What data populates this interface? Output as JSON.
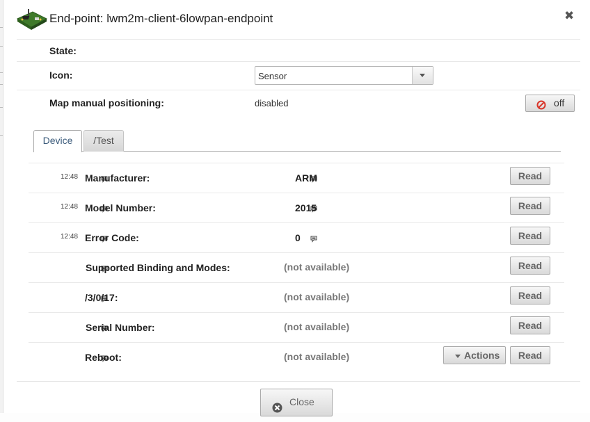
{
  "dialog": {
    "title": "End-point: lwm2m-client-6lowpan-endpoint",
    "icons": {
      "device": "device-board-icon",
      "close": "close-icon"
    },
    "close_symbol": "✖"
  },
  "properties": {
    "state_label": "State:",
    "icon_label": "Icon:",
    "icon_select_value": "Sensor",
    "map_label": "Map manual positioning:",
    "map_value": "disabled",
    "toggle_label": "off"
  },
  "tabs": [
    {
      "label": "Device",
      "active": true
    },
    {
      "label": "/Test",
      "active": false
    }
  ],
  "resources": [
    {
      "time": "12:48",
      "name": "Manufacturer:",
      "value": "ARM",
      "read_label": "Read"
    },
    {
      "time": "12:48",
      "name": "Model Number:",
      "value": "2015",
      "read_label": "Read"
    },
    {
      "time": "12:48",
      "name": "Error Code:",
      "value": "0",
      "read_label": "Read"
    },
    {
      "time": "",
      "name": "Supported Binding and Modes:",
      "value": "(not available)",
      "read_label": "Read"
    },
    {
      "time": "",
      "name": "/3/0/17:",
      "value": "(not available)",
      "read_label": "Read"
    },
    {
      "time": "",
      "name": "Serial Number:",
      "value": "(not available)",
      "read_label": "Read"
    },
    {
      "time": "",
      "name": "Reboot:",
      "value": "(not available)",
      "read_label": "Read",
      "actions_label": "Actions"
    }
  ],
  "footer": {
    "close_label": "Close"
  },
  "colors": {
    "accent_tab_text": "#3a5a7a",
    "ban_red": "#d9362b",
    "close_circle": "#555555"
  }
}
